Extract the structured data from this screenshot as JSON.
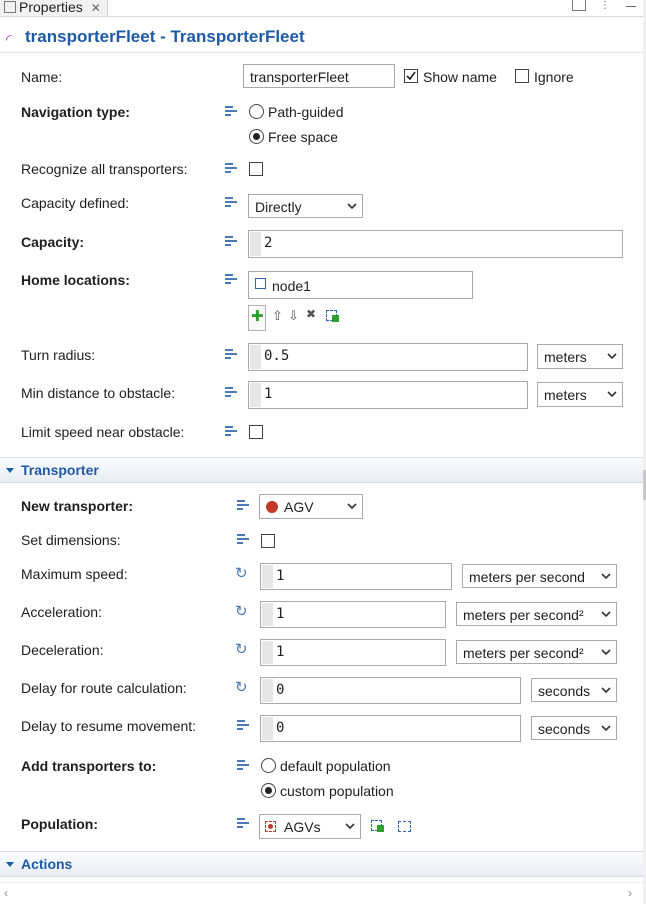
{
  "tab": {
    "title": "Properties",
    "close_icon": "close-icon"
  },
  "header": {
    "title": "transporterFleet - TransporterFleet"
  },
  "fields": {
    "name_label": "Name:",
    "name_value": "transporterFleet",
    "show_name_label": "Show name",
    "ignore_label": "Ignore",
    "navigation_type_label": "Navigation type:",
    "nav_options": [
      "Path-guided",
      "Free space"
    ],
    "nav_selected": "Free space",
    "recognize_label": "Recognize all transporters:",
    "capacity_defined_label": "Capacity defined:",
    "capacity_defined_value": "Directly",
    "capacity_label": "Capacity:",
    "capacity_value": "2",
    "home_locations_label": "Home locations:",
    "home_locations_item": "node1",
    "turn_radius_label": "Turn radius:",
    "turn_radius_value": "0.5",
    "turn_radius_unit": "meters",
    "min_distance_label": "Min distance to obstacle:",
    "min_distance_value": "1",
    "min_distance_unit": "meters",
    "limit_speed_label": "Limit speed near obstacle:"
  },
  "transporter_section": {
    "title": "Transporter",
    "new_transporter_label": "New transporter:",
    "new_transporter_value": "AGV",
    "set_dimensions_label": "Set dimensions:",
    "max_speed_label": "Maximum speed:",
    "max_speed_value": "1",
    "max_speed_unit": "meters per second",
    "acceleration_label": "Acceleration:",
    "acceleration_value": "1",
    "acceleration_unit": "meters per second²",
    "deceleration_label": "Deceleration:",
    "deceleration_value": "1",
    "deceleration_unit": "meters per second²",
    "delay_route_label": "Delay for route calculation:",
    "delay_route_value": "0",
    "delay_route_unit": "seconds",
    "delay_resume_label": "Delay to resume movement:",
    "delay_resume_value": "0",
    "delay_resume_unit": "seconds",
    "add_to_label": "Add transporters to:",
    "add_to_options": [
      "default population",
      "custom population"
    ],
    "add_to_selected": "custom population",
    "population_label": "Population:",
    "population_value": "AGVs"
  },
  "actions_section": {
    "title": "Actions"
  },
  "colors": {
    "accent": "#1f5aa6",
    "icon_blue": "#4a79b8",
    "icon_green": "#2e9e2e"
  }
}
